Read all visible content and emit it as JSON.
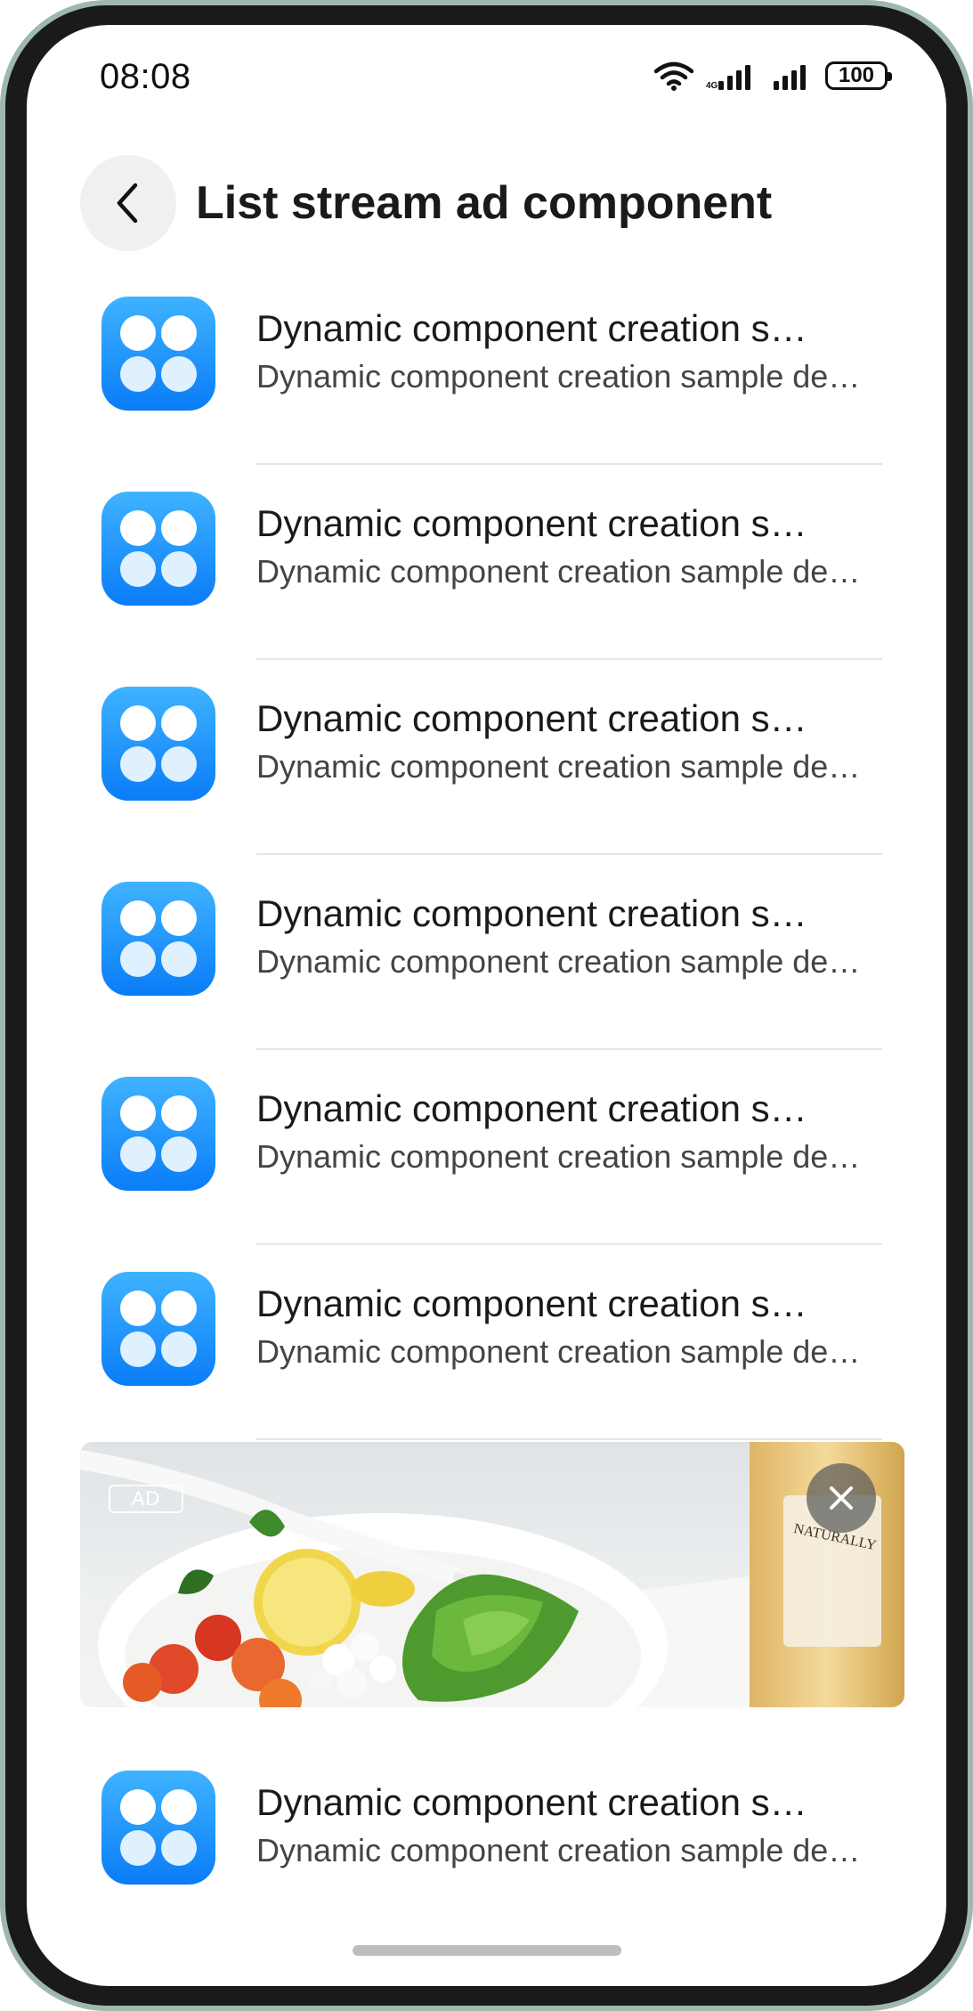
{
  "status_bar": {
    "time": "08:08",
    "battery": "100",
    "icons": [
      "wifi-icon",
      "signal-icon",
      "signal-icon",
      "battery-icon"
    ]
  },
  "header": {
    "title": "List stream ad component",
    "back_icon": "chevron-left-icon"
  },
  "list": {
    "items": [
      {
        "title": "Dynamic component creation sample",
        "subtitle": "Dynamic component creation sample description",
        "icon": "app-grid-icon"
      },
      {
        "title": "Dynamic component creation sample",
        "subtitle": "Dynamic component creation sample description",
        "icon": "app-grid-icon"
      },
      {
        "title": "Dynamic component creation sample",
        "subtitle": "Dynamic component creation sample description",
        "icon": "app-grid-icon"
      },
      {
        "title": "Dynamic component creation sample",
        "subtitle": "Dynamic component creation sample description",
        "icon": "app-grid-icon"
      },
      {
        "title": "Dynamic component creation sample",
        "subtitle": "Dynamic component creation sample description",
        "icon": "app-grid-icon"
      },
      {
        "title": "Dynamic component creation sample",
        "subtitle": "Dynamic component creation sample description",
        "icon": "app-grid-icon"
      }
    ],
    "after_ad": [
      {
        "title": "Dynamic component creation sample",
        "subtitle": "Dynamic component creation sample description",
        "icon": "app-grid-icon"
      }
    ]
  },
  "ad": {
    "badge": "AD",
    "close_icon": "close-icon",
    "image": "salad-bowl-with-bottle",
    "bottle_text": "NATURALLY"
  },
  "colors": {
    "icon_gradient_top": "#3fb3ff",
    "icon_gradient_bottom": "#0a7cf7",
    "divider": "#e6e6e6",
    "bezel": "#9fb8ad"
  }
}
